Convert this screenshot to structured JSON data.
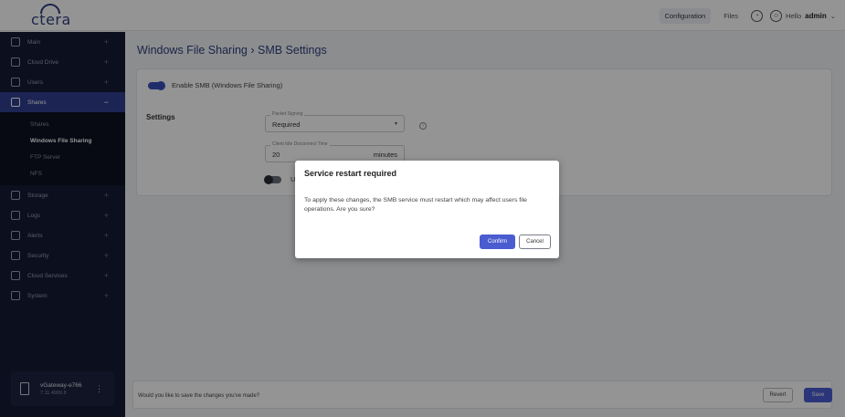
{
  "brand": {
    "logo": "ctera"
  },
  "topbar": {
    "configuration": "Configuration",
    "files": "Files",
    "hello_prefix": "Hello",
    "user": "admin",
    "chevron": "⌄"
  },
  "sidebar": {
    "items": [
      {
        "label": "Main",
        "icon": "grid-icon"
      },
      {
        "label": "Cloud Drive",
        "icon": "cloud-drive-icon"
      },
      {
        "label": "Users",
        "icon": "users-icon"
      },
      {
        "label": "Shares",
        "icon": "share-icon"
      },
      {
        "label": "Storage",
        "icon": "storage-icon"
      },
      {
        "label": "Logs",
        "icon": "logs-icon"
      },
      {
        "label": "Alerts",
        "icon": "bell-icon"
      },
      {
        "label": "Security",
        "icon": "shield-icon"
      },
      {
        "label": "Cloud Services",
        "icon": "cloud-services-icon"
      },
      {
        "label": "System",
        "icon": "system-icon"
      }
    ],
    "shares_sub": [
      "Shares",
      "Windows File Sharing",
      "FTP Server",
      "NFS"
    ],
    "plus": "+",
    "minus": "−",
    "device_name": "vGateway-e766",
    "device_version": "7.11.4900.8",
    "device_menu": "⋮"
  },
  "page": {
    "title": "Windows File Sharing › SMB Settings",
    "enable_label": "Enable SMB (Windows File Sharing)",
    "settings_label": "Settings",
    "packet_signing_label": "Packet Signing",
    "packet_signing_value": "Required",
    "dropdown_arrow": "▾",
    "info": "i",
    "idle_label": "Client Idle Disconnect Time",
    "idle_value": "20",
    "idle_unit": "minutes",
    "use_label": "Use c"
  },
  "footer": {
    "message": "Would you like to save the changes you've made?",
    "revert": "Revert",
    "save": "Save"
  },
  "modal": {
    "title": "Service restart required",
    "body": "To apply these changes, the SMB service must restart which may affect users file operations. Are you sure?",
    "confirm": "Confirm",
    "cancel": "Cancel"
  },
  "colors": {
    "accent": "#4a5cd0",
    "sidebar_bg": "#151b33",
    "active_nav": "#2f3f8f"
  }
}
